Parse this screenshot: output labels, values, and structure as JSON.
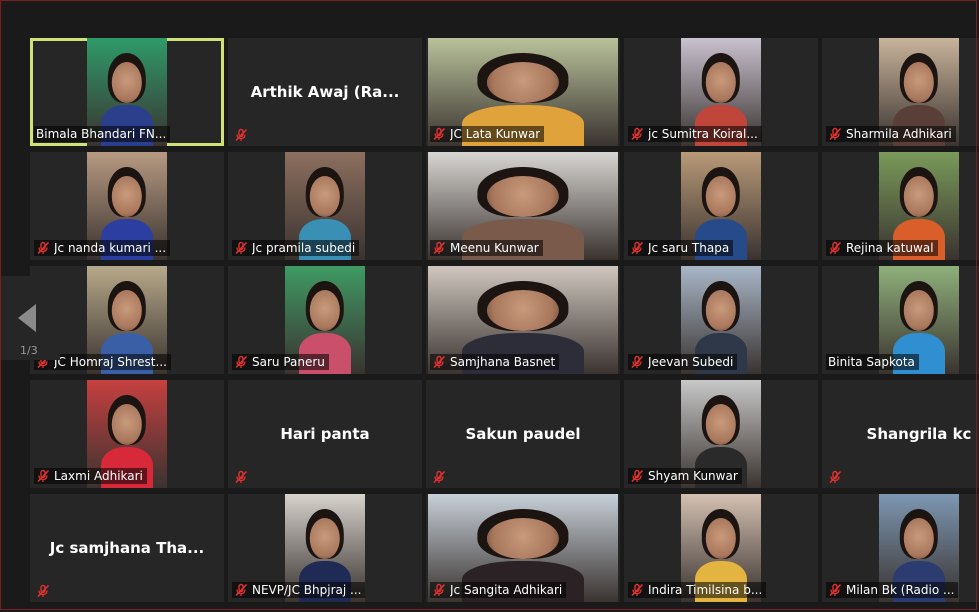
{
  "meeting": {
    "page_indicator": "1/3",
    "speaking_color": "#cfe27a",
    "mic_muted_color": "#e0322f"
  },
  "participants": [
    {
      "name": "Bimala Bhandari  FN...",
      "display": "",
      "video": true,
      "muted": false,
      "speaking": true,
      "bg": "#2f9a6a",
      "shirt": "#2b3f8c"
    },
    {
      "name": "",
      "display": "Arthik Awaj  (Ra...",
      "video": false,
      "muted": true
    },
    {
      "name": "JC Lata Kunwar",
      "display": "",
      "video": true,
      "muted": true,
      "bg": "#b9c29a",
      "shirt": "#e0a23a"
    },
    {
      "name": "jc Sumitra Koiral...",
      "display": "",
      "video": true,
      "muted": true,
      "bg": "#c9c2cf",
      "shirt": "#c0463c"
    },
    {
      "name": "Sharmila Adhikari",
      "display": "",
      "video": true,
      "muted": true,
      "bg": "#c9b49c",
      "shirt": "#5a3f38"
    },
    {
      "name": "Jc nanda kumari ...",
      "display": "",
      "video": true,
      "muted": true,
      "bg": "#b79a82",
      "shirt": "#2c3fa0"
    },
    {
      "name": "Jc pramila subedi",
      "display": "",
      "video": true,
      "muted": true,
      "bg": "#8c6f5e",
      "shirt": "#3a8fb5"
    },
    {
      "name": "Meenu Kunwar",
      "display": "",
      "video": true,
      "muted": true,
      "bg": "#d8d6d2",
      "shirt": "#7a5a4a"
    },
    {
      "name": "Jc saru Thapa",
      "display": "",
      "video": true,
      "muted": true,
      "bg": "#b99a78",
      "shirt": "#274b8a"
    },
    {
      "name": "Rejina katuwal",
      "display": "",
      "video": true,
      "muted": true,
      "bg": "#7a9a5a",
      "shirt": "#d95e2a"
    },
    {
      "name": "JC Homraj Shrest...",
      "display": "",
      "video": true,
      "muted": true,
      "bg": "#b7a98a",
      "shirt": "#3a5fa6"
    },
    {
      "name": "Saru Paneru",
      "display": "",
      "video": true,
      "muted": true,
      "bg": "#3f9a64",
      "shirt": "#c94f6a"
    },
    {
      "name": "Samjhana Basnet",
      "display": "",
      "video": true,
      "muted": true,
      "bg": "#cfc7bf",
      "shirt": "#2d2d3a"
    },
    {
      "name": "Jeevan Subedi",
      "display": "",
      "video": true,
      "muted": true,
      "bg": "#a9b7c8",
      "shirt": "#2e3848"
    },
    {
      "name": "Binita Sapkota",
      "display": "",
      "video": true,
      "muted": false,
      "bg": "#8fb07a",
      "shirt": "#2f8fd0"
    },
    {
      "name": "Laxmi Adhikari",
      "display": "",
      "video": true,
      "muted": true,
      "bg": "#c64040",
      "shirt": "#d7293a"
    },
    {
      "name": "",
      "display": "Hari panta",
      "video": false,
      "muted": true
    },
    {
      "name": "",
      "display": "Sakun paudel",
      "video": false,
      "muted": true
    },
    {
      "name": "Shyam Kunwar",
      "display": "",
      "video": true,
      "muted": true,
      "bg": "#c8c8c8",
      "shirt": "#2a2a2a"
    },
    {
      "name": "",
      "display": "Shangrila kc",
      "video": false,
      "muted": true
    },
    {
      "name": "",
      "display": "Jc samjhana Tha...",
      "video": false,
      "muted": true
    },
    {
      "name": "NEVP/JC Bhpjraj ...",
      "display": "",
      "video": true,
      "muted": true,
      "bg": "#d6d2cc",
      "shirt": "#1f2a55"
    },
    {
      "name": "Jc Sangita Adhikari",
      "display": "",
      "video": true,
      "muted": true,
      "bg": "#c7d0d8",
      "shirt": "#2a2224"
    },
    {
      "name": "Indira Timilsina b...",
      "display": "",
      "video": true,
      "muted": true,
      "bg": "#d4c0b2",
      "shirt": "#e4b440"
    },
    {
      "name": "Milan Bk (Radio ...",
      "display": "",
      "video": true,
      "muted": true,
      "bg": "#7d97b3",
      "shirt": "#2c3c70"
    }
  ]
}
